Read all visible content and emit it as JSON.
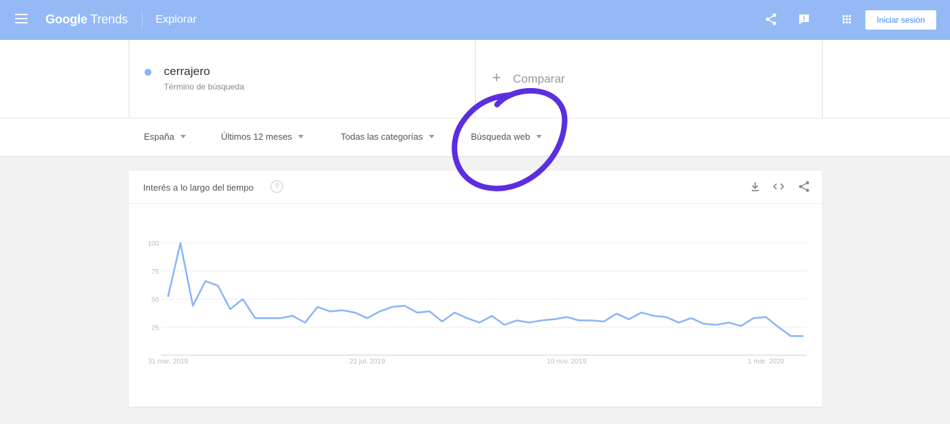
{
  "topbar": {
    "logo_text_bold": "Google",
    "logo_text": " Trends",
    "page_title": "Explorar",
    "signin_label": "Iniciar sesión",
    "icons": [
      "menu-icon",
      "share-icon",
      "feedback-icon",
      "apps-icon"
    ]
  },
  "search": {
    "term": "cerrajero",
    "term_type": "Término de búsqueda",
    "term_color": "#8ab4f8",
    "compare_label": "Comparar"
  },
  "filters": {
    "geo": "España",
    "time": "Últimos 12 meses",
    "category": "Todas las categorías",
    "property": "Búsqueda web"
  },
  "chart_card": {
    "title": "Interés a lo largo del tiempo",
    "help_symbol": "?",
    "icons": [
      "download-icon",
      "embed-icon",
      "share-icon"
    ]
  },
  "annotation": {
    "color": "#5b2ee0"
  },
  "chart_data": {
    "type": "line",
    "title": "Interés a lo largo del tiempo",
    "xlabel": "",
    "ylabel": "",
    "ylim": [
      0,
      100
    ],
    "yticks": [
      25,
      50,
      75,
      100
    ],
    "xtick_labels": [
      "31 mar. 2019",
      "21 jul. 2019",
      "10 nov. 2019",
      "1 mar. 2020"
    ],
    "xtick_indices": [
      0,
      16,
      32,
      48
    ],
    "grid": true,
    "legend": "none",
    "series": [
      {
        "color": "#8ab4f8",
        "values": [
          52,
          100,
          44,
          66,
          62,
          41,
          50,
          33,
          33,
          33,
          35,
          29,
          43,
          39,
          40,
          38,
          33,
          39,
          43,
          44,
          38,
          39,
          30,
          38,
          33,
          29,
          35,
          27,
          31,
          29,
          31,
          32,
          34,
          31,
          31,
          30,
          37,
          32,
          38,
          35,
          34,
          29,
          33,
          28,
          27,
          29,
          26,
          33,
          34,
          25,
          17,
          17
        ]
      }
    ]
  }
}
